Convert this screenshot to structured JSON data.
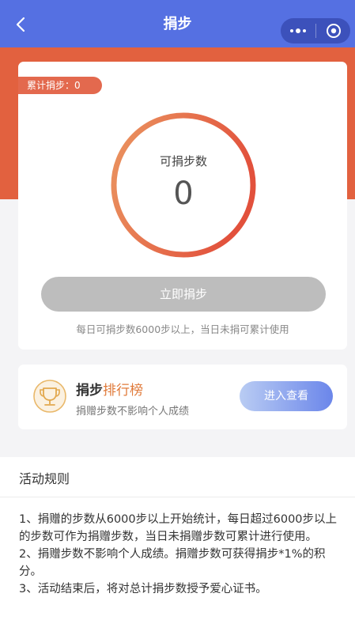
{
  "navbar": {
    "title": "捐步",
    "more_icon": "more-dots-icon",
    "close_icon": "mini-program-close-icon"
  },
  "stats": {
    "total_label": "累计捐步：0",
    "ring_label": "可捐步数",
    "ring_value": "0"
  },
  "donate": {
    "button_label": "立即捐步",
    "hint": "每日可捐步数6000步以上，当日未捐可累计使用"
  },
  "ranking": {
    "title_prefix": "捐步",
    "title_accent": "排行榜",
    "subtitle": "捐赠步数不影响个人成绩",
    "button_label": "进入查看",
    "icon": "trophy-icon"
  },
  "rules": {
    "title": "活动规则",
    "items": [
      "1、捐赠的步数从6000步以上开始统计，每日超过6000步以上的步数可作为捐赠步数，当日未捐赠步数可累计进行使用。",
      "2、捐赠步数不影响个人成绩。捐赠步数可获得捐步*1%的积分。",
      "3、活动结束后，将对总计捐步数授予爱心证书。"
    ]
  },
  "colors": {
    "navbar": "#5570e2",
    "hero": "#e2613f",
    "accent": "#e07a3a",
    "ring_start": "#ea9560",
    "ring_end": "#e2513c"
  }
}
